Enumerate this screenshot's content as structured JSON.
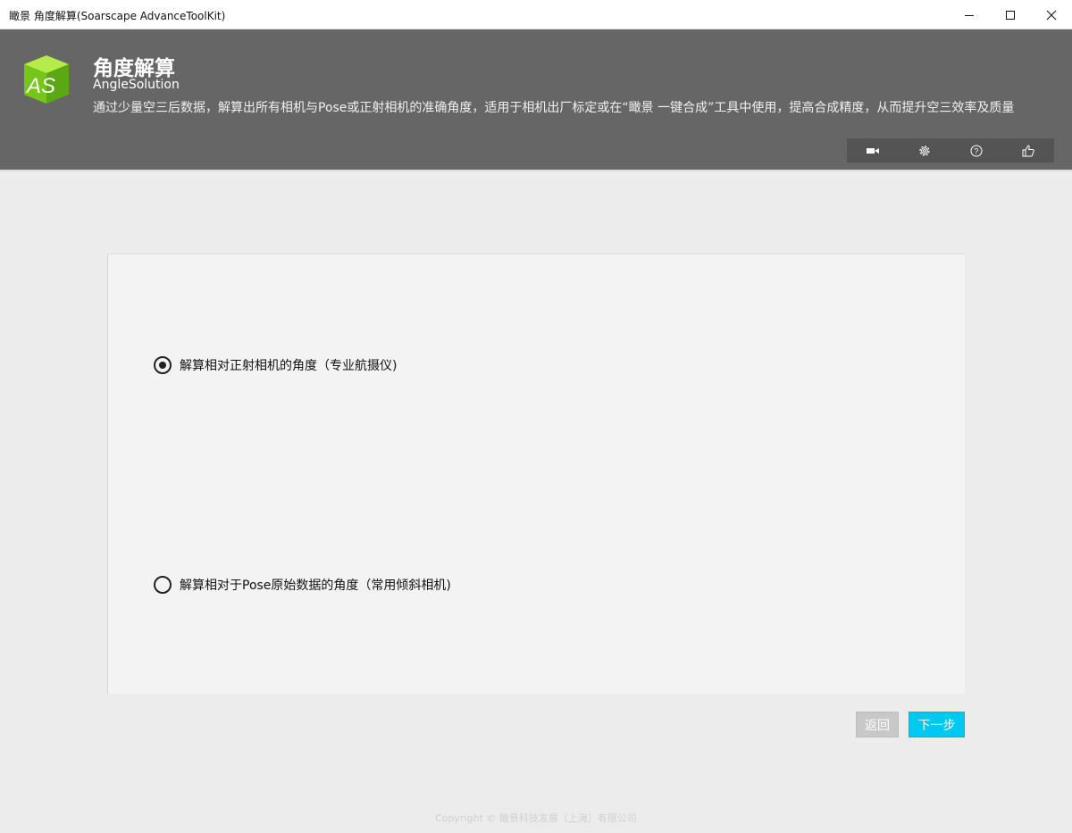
{
  "window": {
    "title": "瞰景 角度解算(Soarscape AdvanceToolKit)"
  },
  "header": {
    "title": "角度解算",
    "subtitle": "AngleSolution",
    "description": "通过少量空三后数据，解算出所有相机与Pose或正射相机的准确角度，适用于相机出厂标定或在“瞰景 一键合成”工具中使用，提高合成精度，从而提升空三效率及质量",
    "logo_text": "AS",
    "toolbar_icons": [
      "video-camera-icon",
      "gear-icon",
      "help-icon",
      "thumbs-up-icon"
    ]
  },
  "options": [
    {
      "label": "解算相对正射相机的角度（专业航摄仪)",
      "selected": true
    },
    {
      "label": "解算相对于Pose原始数据的角度（常用倾斜相机)",
      "selected": false
    }
  ],
  "buttons": {
    "back": "返回",
    "next": "下一步"
  },
  "footer": {
    "copyright": "Copyright © 瞰景科技发展（上海）有限公司"
  },
  "colors": {
    "header_bg": "#666666",
    "accent": "#00c8f0",
    "logo_green": "#7ed321"
  }
}
